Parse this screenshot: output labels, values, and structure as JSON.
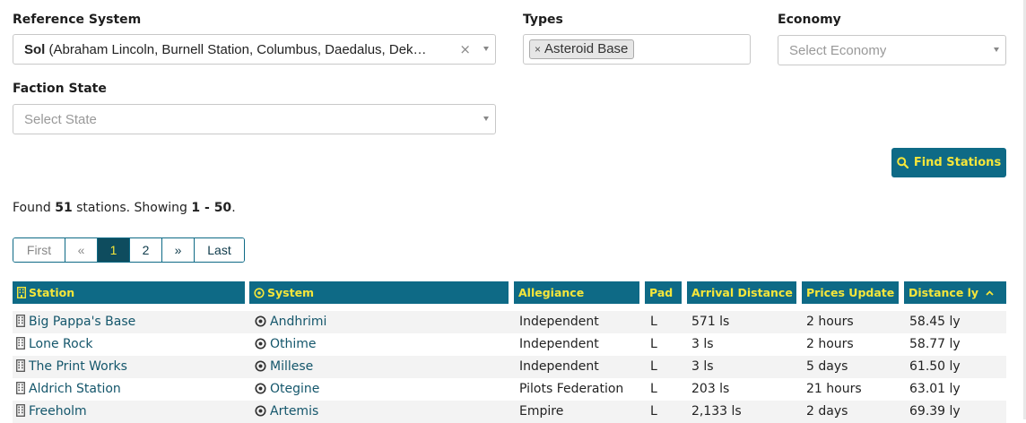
{
  "filters": {
    "reference_system": {
      "label": "Reference System",
      "value_bold": "Sol",
      "value_rest": " (Abraham Lincoln, Burnell Station, Columbus, Daedalus, Dek…",
      "clear": "×"
    },
    "types": {
      "label": "Types",
      "tag": "Asteroid Base",
      "tag_remove": "×"
    },
    "economy": {
      "label": "Economy",
      "placeholder": "Select Economy"
    },
    "faction_state": {
      "label": "Faction State",
      "placeholder": "Select State"
    }
  },
  "find_button": {
    "label": "Find Stations",
    "icon": "search-icon"
  },
  "results": {
    "prefix": "Found ",
    "count": "51",
    "middle": " stations. Showing ",
    "range": "1 - 50",
    "suffix": "."
  },
  "pagination": [
    "First",
    "«",
    "1",
    "2",
    "»",
    "Last"
  ],
  "table": {
    "headers": {
      "station": "Station",
      "system": "System",
      "allegiance": "Allegiance",
      "pad": "Pad",
      "arrival": "Arrival Distance",
      "prices": "Prices Update",
      "distance": "Distance ly"
    },
    "rows": [
      {
        "station": "Big Pappa's Base",
        "system": "Andhrimi",
        "allegiance": "Independent",
        "pad": "L",
        "arrival": "571 ls",
        "prices": "2 hours",
        "distance": "58.45 ly"
      },
      {
        "station": "Lone Rock",
        "system": "Othime",
        "allegiance": "Independent",
        "pad": "L",
        "arrival": "3 ls",
        "prices": "2 hours",
        "distance": "58.77 ly"
      },
      {
        "station": "The Print Works",
        "system": "Millese",
        "allegiance": "Independent",
        "pad": "L",
        "arrival": "3 ls",
        "prices": "5 days",
        "distance": "61.50 ly"
      },
      {
        "station": "Aldrich Station",
        "system": "Otegine",
        "allegiance": "Pilots Federation",
        "pad": "L",
        "arrival": "203 ls",
        "prices": "21 hours",
        "distance": "63.01 ly"
      },
      {
        "station": "Freeholm",
        "system": "Artemis",
        "allegiance": "Empire",
        "pad": "L",
        "arrival": "2,133 ls",
        "prices": "2 days",
        "distance": "69.39 ly"
      }
    ]
  },
  "colors": {
    "accent": "#0e6a86",
    "header_text": "#f5e63a",
    "link": "#14566b"
  }
}
